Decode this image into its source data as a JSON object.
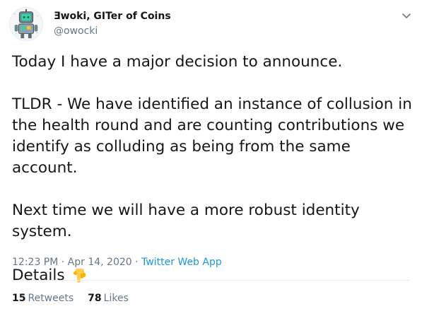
{
  "author": {
    "display_name": "Ǝwoki, GITer of Coins",
    "handle": "@owocki",
    "avatar_icon": "robot-avatar-icon"
  },
  "tweet": {
    "lines": [
      "Today I have a major decision to announce.",
      "TLDR - We have identified an instance of collusion in the health round and are counting contributions we identify as colluding as being from the same account.",
      "Next time we will have a more robust identity system.",
      "Details"
    ],
    "emoji_icon": "backhand-index-pointing-down-icon"
  },
  "meta": {
    "time": "12:23 PM · Apr 14, 2020",
    "separator": " · ",
    "source": "Twitter Web App"
  },
  "stats": {
    "retweets_count": "15",
    "retweets_label": "Retweets",
    "likes_count": "78",
    "likes_label": "Likes"
  },
  "colors": {
    "text": "#14171a",
    "secondary": "#657786",
    "link": "#1b95e0",
    "divider": "#e6ecf0"
  }
}
